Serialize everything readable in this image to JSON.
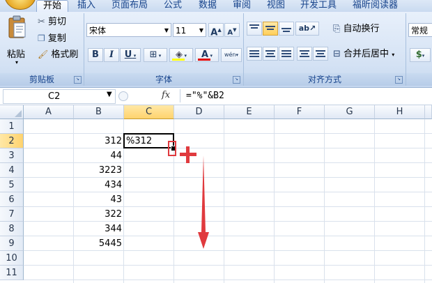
{
  "tabs": [
    "开始",
    "插入",
    "页面布局",
    "公式",
    "数据",
    "审阅",
    "视图",
    "开发工具",
    "福昕阅读器"
  ],
  "clipboard": {
    "paste": "粘贴",
    "cut": "剪切",
    "copy": "复制",
    "format_painter": "格式刷",
    "group": "剪贴板"
  },
  "font": {
    "name": "宋体",
    "size": "11",
    "bold": "B",
    "italic": "I",
    "underline": "U",
    "font_color_letter": "A",
    "wen": "wén",
    "group": "字体",
    "grow": "A",
    "shrink": "A"
  },
  "alignment": {
    "wrap_text": "自动换行",
    "merge_center": "合并后居中",
    "group": "对齐方式"
  },
  "number": {
    "format": "常规"
  },
  "formula_bar": {
    "name_box": "C2",
    "fx": "fx",
    "formula": "=\"%\"&B2"
  },
  "columns": [
    "A",
    "B",
    "C",
    "D",
    "E",
    "F",
    "G",
    "H"
  ],
  "rows": [
    "1",
    "2",
    "3",
    "4",
    "5",
    "6",
    "7",
    "8",
    "9",
    "10",
    "11"
  ],
  "cells": {
    "B2": "312",
    "B3": "44",
    "B4": "3223",
    "B5": "434",
    "B6": "43",
    "B7": "322",
    "B8": "344",
    "B9": "5445",
    "C2": "%312"
  },
  "colors": {
    "accent": "#15428b",
    "annotation": "#e03a3e",
    "selection": "#000000"
  }
}
